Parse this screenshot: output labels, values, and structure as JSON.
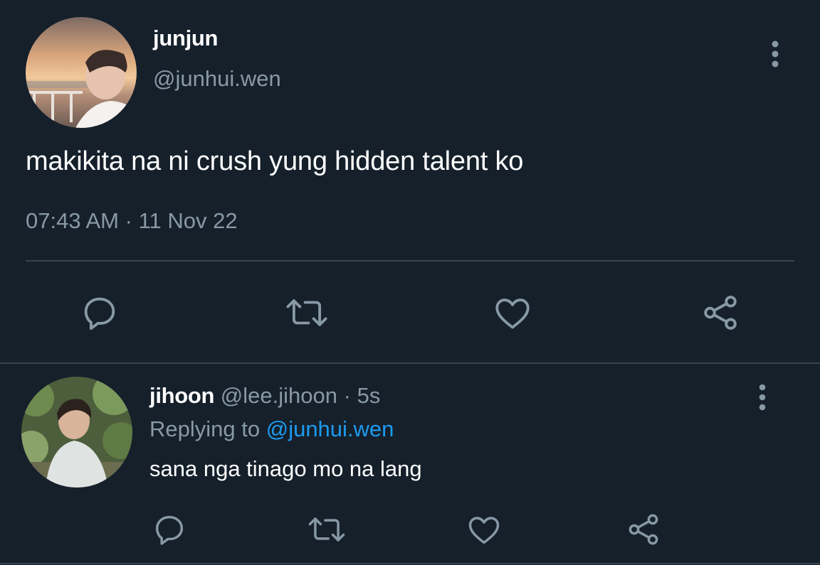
{
  "colors": {
    "background": "#15202b",
    "primary_text": "#ffffff",
    "secondary_text": "#8899a6",
    "mention": "#1d9bf0",
    "divider": "#38444d"
  },
  "main_tweet": {
    "display_name": "junjun",
    "handle": "@junhui.wen",
    "text": "makikita na ni crush yung hidden talent ko",
    "time": "07:43 AM",
    "separator": "·",
    "date": "11 Nov 22",
    "avatar_icon": "profile-photo",
    "actions": [
      "reply-icon",
      "retweet-icon",
      "like-icon",
      "share-icon"
    ],
    "more_icon": "more-vertical-icon"
  },
  "reply_tweet": {
    "display_name": "jihoon",
    "handle": "@lee.jihoon",
    "separator": "·",
    "time": "5s",
    "replying_label": "Replying to",
    "replying_mention": "@junhui.wen",
    "text": "sana nga tinago mo na lang",
    "avatar_icon": "profile-photo",
    "actions": [
      "reply-icon",
      "retweet-icon",
      "like-icon",
      "share-icon"
    ],
    "more_icon": "more-vertical-icon"
  }
}
